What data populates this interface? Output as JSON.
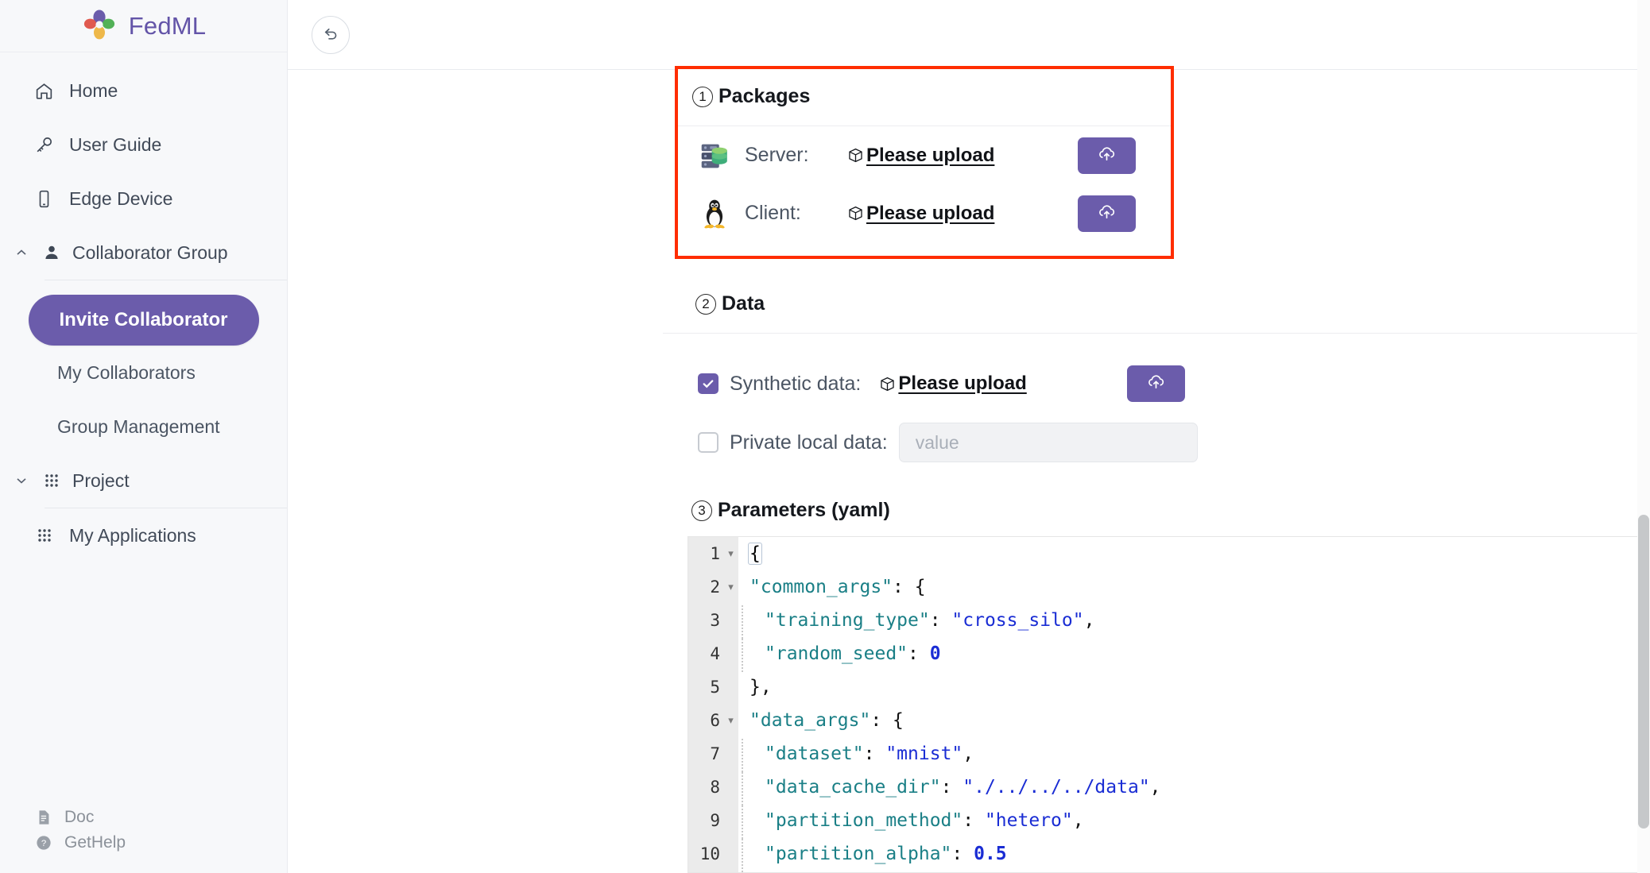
{
  "brand": {
    "name": "FedML",
    "logo_icon": "fedml-flower-logo",
    "colors": {
      "purple": "#6b5cab",
      "red": "#e05a4f",
      "green": "#52b157",
      "yellow": "#eeb84a"
    }
  },
  "sidebar": {
    "items": [
      {
        "label": "Home",
        "icon": "home-icon"
      },
      {
        "label": "User Guide",
        "icon": "key-icon"
      },
      {
        "label": "Edge Device",
        "icon": "mobile-device-icon"
      }
    ],
    "groups": [
      {
        "label": "Collaborator Group",
        "icon": "user-icon",
        "chevron": "chevron-up-icon",
        "expanded": true,
        "primary_action": "Invite Collaborator",
        "children": [
          {
            "label": "My Collaborators"
          },
          {
            "label": "Group Management"
          }
        ]
      },
      {
        "label": "Project",
        "icon": "grid-dots-icon",
        "chevron": "chevron-down-icon",
        "expanded": true,
        "children": [
          {
            "label": "My Applications",
            "icon": "grid-dots-icon"
          }
        ]
      }
    ],
    "footer": [
      {
        "label": "Doc",
        "icon": "document-icon"
      },
      {
        "label": "GetHelp",
        "icon": "question-circle-icon"
      }
    ]
  },
  "topbar": {
    "back_icon": "undo-arrow-icon"
  },
  "packages": {
    "number": "1",
    "title": "Packages",
    "highlighted": true,
    "highlight_color": "#ff2d00",
    "rows": [
      {
        "label": "Server:",
        "icon": "server-database-icon",
        "link": "Please upload",
        "link_icon": "package-box-icon",
        "button_icon": "cloud-upload-icon"
      },
      {
        "label": "Client:",
        "icon": "linux-penguin-icon",
        "link": "Please upload",
        "link_icon": "package-box-icon",
        "button_icon": "cloud-upload-icon"
      }
    ]
  },
  "data": {
    "number": "2",
    "title": "Data",
    "synthetic": {
      "label": "Synthetic data:",
      "checked": true,
      "link": "Please upload",
      "link_icon": "package-box-icon",
      "button_icon": "cloud-upload-icon"
    },
    "private": {
      "label": "Private local data:",
      "checked": false,
      "value": "",
      "placeholder": "value"
    }
  },
  "parameters": {
    "number": "3",
    "title": "Parameters (yaml)",
    "code_lines": [
      {
        "num": "1",
        "fold": "▾",
        "indent": 0,
        "tokens": [
          {
            "t": "{",
            "c": "brkt"
          }
        ]
      },
      {
        "num": "2",
        "fold": "▾",
        "indent": 0,
        "tokens": [
          {
            "t": "\"common_args\"",
            "c": "k"
          },
          {
            "t": ": {",
            "c": "p"
          }
        ]
      },
      {
        "num": "3",
        "fold": "",
        "indent": 1,
        "tokens": [
          {
            "t": "\"training_type\"",
            "c": "k"
          },
          {
            "t": ": ",
            "c": "p"
          },
          {
            "t": "\"cross_silo\"",
            "c": "s"
          },
          {
            "t": ",",
            "c": "p"
          }
        ]
      },
      {
        "num": "4",
        "fold": "",
        "indent": 1,
        "tokens": [
          {
            "t": "\"random_seed\"",
            "c": "k"
          },
          {
            "t": ": ",
            "c": "p"
          },
          {
            "t": "0",
            "c": "n"
          }
        ]
      },
      {
        "num": "5",
        "fold": "",
        "indent": 0,
        "tokens": [
          {
            "t": "},",
            "c": "p"
          }
        ]
      },
      {
        "num": "6",
        "fold": "▾",
        "indent": 0,
        "tokens": [
          {
            "t": "\"data_args\"",
            "c": "k"
          },
          {
            "t": ": {",
            "c": "p"
          }
        ]
      },
      {
        "num": "7",
        "fold": "",
        "indent": 1,
        "tokens": [
          {
            "t": "\"dataset\"",
            "c": "k"
          },
          {
            "t": ": ",
            "c": "p"
          },
          {
            "t": "\"mnist\"",
            "c": "s"
          },
          {
            "t": ",",
            "c": "p"
          }
        ]
      },
      {
        "num": "8",
        "fold": "",
        "indent": 1,
        "tokens": [
          {
            "t": "\"data_cache_dir\"",
            "c": "k"
          },
          {
            "t": ": ",
            "c": "p"
          },
          {
            "t": "\"./../../../data\"",
            "c": "s"
          },
          {
            "t": ",",
            "c": "p"
          }
        ]
      },
      {
        "num": "9",
        "fold": "",
        "indent": 1,
        "tokens": [
          {
            "t": "\"partition_method\"",
            "c": "k"
          },
          {
            "t": ": ",
            "c": "p"
          },
          {
            "t": "\"hetero\"",
            "c": "s"
          },
          {
            "t": ",",
            "c": "p"
          }
        ]
      },
      {
        "num": "10",
        "fold": "",
        "indent": 1,
        "tokens": [
          {
            "t": "\"partition_alpha\"",
            "c": "k"
          },
          {
            "t": ": ",
            "c": "p"
          },
          {
            "t": "0.5",
            "c": "n"
          }
        ]
      }
    ]
  },
  "scroll_top_button": {
    "icon": "arrow-to-top-icon"
  }
}
